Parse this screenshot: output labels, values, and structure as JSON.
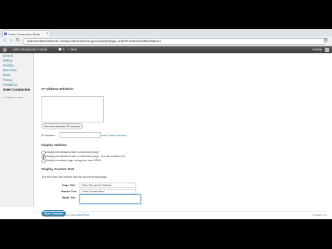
{
  "browser": {
    "tab_title": "Under Construction Settin",
    "url": "videowordpresstutorial.com/wp-admin/options-general.php?page=underConstructionMainOptions"
  },
  "admin_bar": {
    "site_name": "Video Wordpress Tutorial",
    "comments_count": "0",
    "new_label": "+ New",
    "howdy": "Howdy,"
  },
  "sidebar": {
    "items": [
      "General",
      "Writing",
      "Reading",
      "Discussion",
      "Media",
      "Privacy",
      "Permalinks",
      "Under Construction"
    ],
    "collapse_label": "Collapse menu"
  },
  "ip_whitelist": {
    "heading": "IP Address Whitelist",
    "remove_button": "Remove Selected IP Address",
    "ip_label": "IP Address",
    "add_link": "Add Current Address"
  },
  "display_options": {
    "heading": "Display Options",
    "options": [
      "Display the default under construction page",
      "Display the default under construction page , but use custom text",
      "Display a custom page using your own HTML"
    ],
    "selected_index": 1
  },
  "custom_text": {
    "heading": "Display Custom Text",
    "description": "The text here will replace the text on the default page",
    "page_title_label": "Page Title",
    "page_title_value": "Video Wordpress Tutorial",
    "header_text_label": "Header Text",
    "header_text_value": "Under Construction",
    "body_text_label": "Body Text",
    "body_text_value": ""
  },
  "save_button": "Save Changes",
  "footer": {
    "thanks_prefix": "Thank you for creating with ",
    "thanks_link": "WordPress",
    "version": "Version 3.4"
  },
  "colors": {
    "link": "#21759b",
    "primary_button": "#2e8ac0",
    "admin_bar": "#464646"
  }
}
